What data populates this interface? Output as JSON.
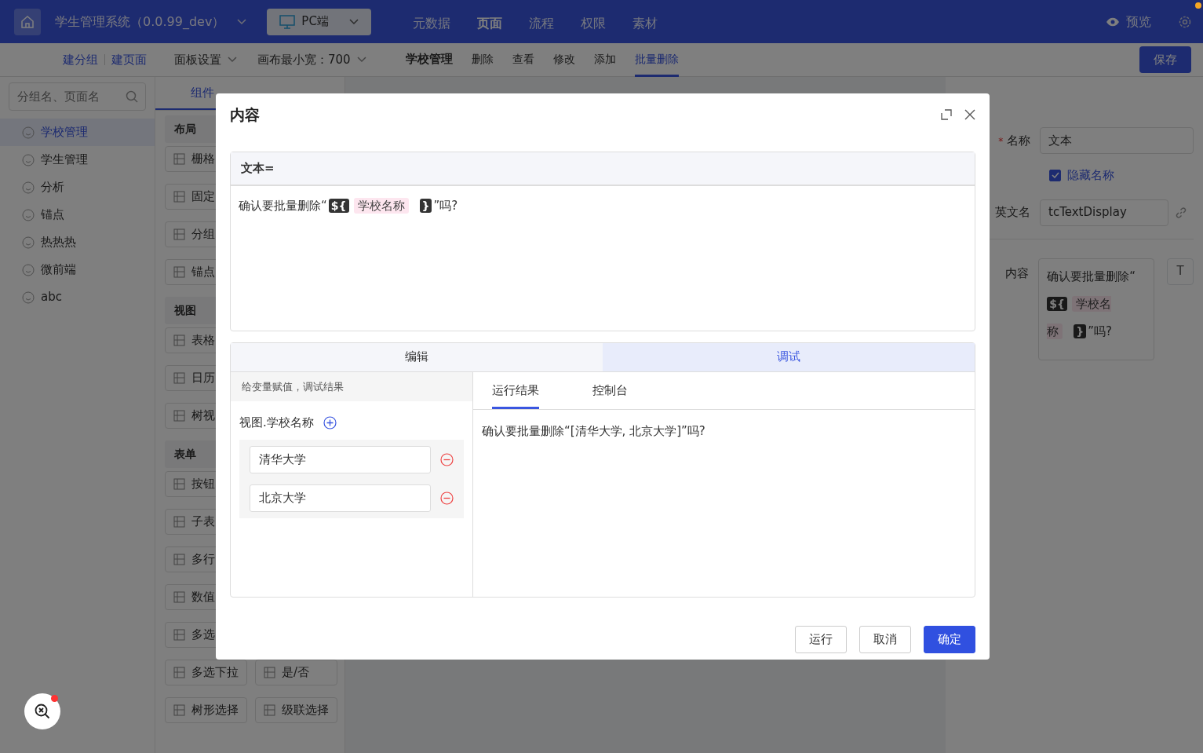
{
  "header": {
    "title": "学生管理系统（0.0.99_dev）",
    "platform": "PC端",
    "nav": [
      {
        "label": "元数据",
        "selected": false
      },
      {
        "label": "页面",
        "selected": true
      },
      {
        "label": "流程",
        "selected": false
      },
      {
        "label": "权限",
        "selected": false
      },
      {
        "label": "素材",
        "selected": false
      }
    ],
    "preview": "预览",
    "has_notification": true
  },
  "toolbar": {
    "links": [
      "建分组",
      "建页面"
    ],
    "panel_settings": "面板设置",
    "canvas_width": "画布最小宽：700",
    "page_tabs": [
      {
        "label": "学校管理",
        "kind": "page",
        "selected": false
      },
      {
        "label": "删除",
        "kind": "action",
        "selected": false
      },
      {
        "label": "查看",
        "kind": "action",
        "selected": false
      },
      {
        "label": "修改",
        "kind": "action",
        "selected": false
      },
      {
        "label": "添加",
        "kind": "action",
        "selected": false
      },
      {
        "label": "批量删除",
        "kind": "action",
        "selected": true
      }
    ],
    "save": "保存"
  },
  "sidebar": {
    "search_placeholder": "分组名、页面名",
    "items": [
      {
        "label": "学校管理",
        "selected": true
      },
      {
        "label": "学生管理",
        "selected": false
      },
      {
        "label": "分析",
        "selected": false
      },
      {
        "label": "锚点",
        "selected": false
      },
      {
        "label": "热热热",
        "selected": false
      },
      {
        "label": "微前端",
        "selected": false
      },
      {
        "label": "abc",
        "selected": false
      }
    ]
  },
  "components": {
    "tab": "组件",
    "groups": [
      {
        "title": "布局",
        "rows": [
          [
            "栅格"
          ],
          [
            "固定"
          ],
          [
            "分组"
          ],
          [
            "锚点"
          ]
        ]
      },
      {
        "title": "视图",
        "rows": [
          [
            "表格"
          ],
          [
            "日历"
          ],
          [
            "树视"
          ]
        ]
      },
      {
        "title": "表单",
        "rows": [
          [
            "按钮"
          ],
          [
            "子表"
          ],
          [
            "多行"
          ],
          [
            "数值"
          ],
          [
            "多选"
          ],
          [
            "多选下拉",
            "是/否"
          ],
          [
            "树形选择",
            "级联选择"
          ]
        ]
      }
    ]
  },
  "properties": {
    "name_label": "名称",
    "required_mark": "*",
    "name_value": "文本",
    "hide_name": {
      "label": "隐藏名称",
      "checked": true
    },
    "en_label": "英文名",
    "en_value": "tcTextDisplay",
    "content_label": "内容",
    "type_button": "T",
    "content": [
      {
        "kind": "text",
        "text": "确认要批量删除“"
      },
      {
        "kind": "open",
        "text": "${"
      },
      {
        "kind": "var",
        "text": "学校名称"
      },
      {
        "kind": "close",
        "text": "}"
      },
      {
        "kind": "text",
        "text": "”吗?"
      }
    ]
  },
  "dialog": {
    "title": "内容",
    "expr_label": "文本=",
    "expression": [
      {
        "kind": "text",
        "text": "确认要批量删除“"
      },
      {
        "kind": "open",
        "text": "${"
      },
      {
        "kind": "var",
        "text": "学校名称"
      },
      {
        "kind": "close",
        "text": "}"
      },
      {
        "kind": "text",
        "text": "”吗?"
      }
    ],
    "mode_tabs": [
      {
        "label": "编辑",
        "selected": false
      },
      {
        "label": "调试",
        "selected": true
      }
    ],
    "hint": "给变量赋值，调试结果",
    "variable": "视图.学校名称",
    "values": [
      "清华大学",
      "北京大学"
    ],
    "result_tabs": [
      {
        "label": "运行结果",
        "selected": true
      },
      {
        "label": "控制台",
        "selected": false
      }
    ],
    "result": "确认要批量删除“[清华大学, 北京大学]”吗?",
    "buttons": [
      {
        "label": "运行",
        "kind": "default"
      },
      {
        "label": "取消",
        "kind": "default"
      },
      {
        "label": "确定",
        "kind": "primary"
      }
    ]
  }
}
